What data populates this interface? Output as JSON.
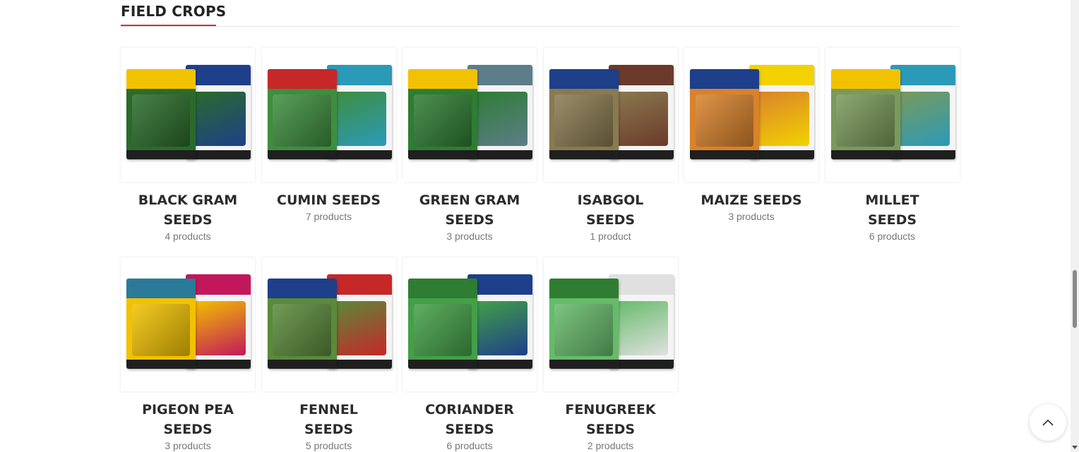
{
  "section": {
    "title": "FIELD CROPS"
  },
  "categories": [
    {
      "name": "BLACK GRAM SEEDS",
      "count": "4 products",
      "colors": [
        "#f2c200",
        "#2a6b2a",
        "#1e3f8a"
      ]
    },
    {
      "name": "CUMIN SEEDS",
      "count": "7 products",
      "colors": [
        "#c62828",
        "#3e8e3e",
        "#2b9ab8"
      ]
    },
    {
      "name": "GREEN GRAM SEEDS",
      "count": "3 products",
      "colors": [
        "#f2c200",
        "#2e7d32",
        "#5d7d8a"
      ]
    },
    {
      "name": "ISABGOL SEEDS",
      "count": "1 product",
      "colors": [
        "#1e3f8a",
        "#8a7a50",
        "#6b3a2a"
      ]
    },
    {
      "name": "MAIZE SEEDS",
      "count": "3 products",
      "colors": [
        "#1e3f8a",
        "#d9822b",
        "#f2d200"
      ]
    },
    {
      "name": "MILLET SEEDS",
      "count": "6 products",
      "colors": [
        "#f2c200",
        "#7a9a5a",
        "#2b9ab8"
      ]
    },
    {
      "name": "PIGEON PEA SEEDS",
      "count": "3 products",
      "colors": [
        "#2a7a9a",
        "#f2c200",
        "#c2185b"
      ]
    },
    {
      "name": "FENNEL SEEDS",
      "count": "5 products",
      "colors": [
        "#1e3f8a",
        "#5a8a3a",
        "#c62828"
      ]
    },
    {
      "name": "CORIANDER SEEDS",
      "count": "6 products",
      "colors": [
        "#2e7d32",
        "#43a047",
        "#1e3f8a"
      ]
    },
    {
      "name": "FENUGREEK SEEDS",
      "count": "2 products",
      "colors": [
        "#2e7d32",
        "#66bb6a",
        "#e0e0e0"
      ]
    }
  ],
  "icons": {
    "scroll_top": "chevron-up-icon"
  }
}
